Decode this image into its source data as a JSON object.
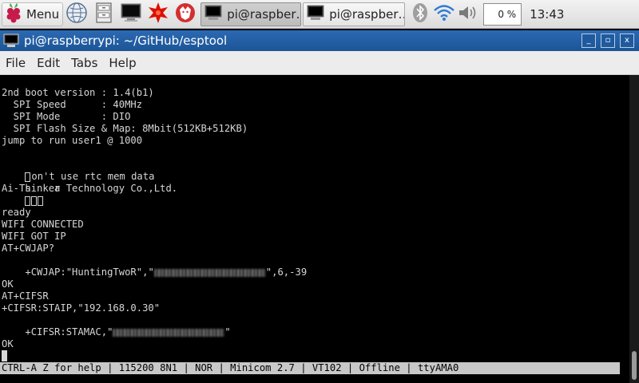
{
  "panel": {
    "menu_label": "Menu",
    "icons": [
      "raspberry-icon",
      "web-browser-icon",
      "file-manager-icon",
      "terminal-icon",
      "wolfram-icon",
      "mathematica-icon"
    ],
    "tasks": [
      {
        "label": "pi@raspber…",
        "active": true
      },
      {
        "label": "pi@raspber…",
        "active": false
      }
    ],
    "cpu_usage": "0 %",
    "clock": "13:43"
  },
  "window": {
    "title": "pi@raspberrypi: ~/GitHub/esptool",
    "controls": {
      "minimize": "_",
      "maximize": "▫",
      "close": "x"
    }
  },
  "menubar": {
    "items": [
      "File",
      "Edit",
      "Tabs",
      "Help"
    ]
  },
  "terminal": {
    "lines": [
      "2nd boot version : 1.4(b1)",
      "  SPI Speed      : 40MHz",
      "  SPI Mode       : DIO",
      "  SPI Flash Size & Map: 8Mbit(512KB+512KB)",
      "jump to run user1 @ 1000",
      "",
      "on't use rtc mem data",
      "s    a",
      "Ai-Thinker Technology Co.,Ltd.",
      "",
      "ready",
      "WIFI CONNECTED",
      "WIFI GOT IP",
      "AT+CWJAP?",
      "+CWJAP:\"HuntingTwoR\",\"",
      "",
      "OK",
      "AT+CIFSR",
      "+CIFSR:STAIP,\"192.168.0.30\"",
      "+CIFSR:STAMAC,\"",
      "",
      "OK"
    ],
    "cwjap_suffix": "\",6,-39",
    "stamac_suffix": "\"",
    "status_line": "CTRL-A Z for help | 115200 8N1 | NOR | Minicom 2.7 | VT102 | Offline | ttyAMA0"
  }
}
